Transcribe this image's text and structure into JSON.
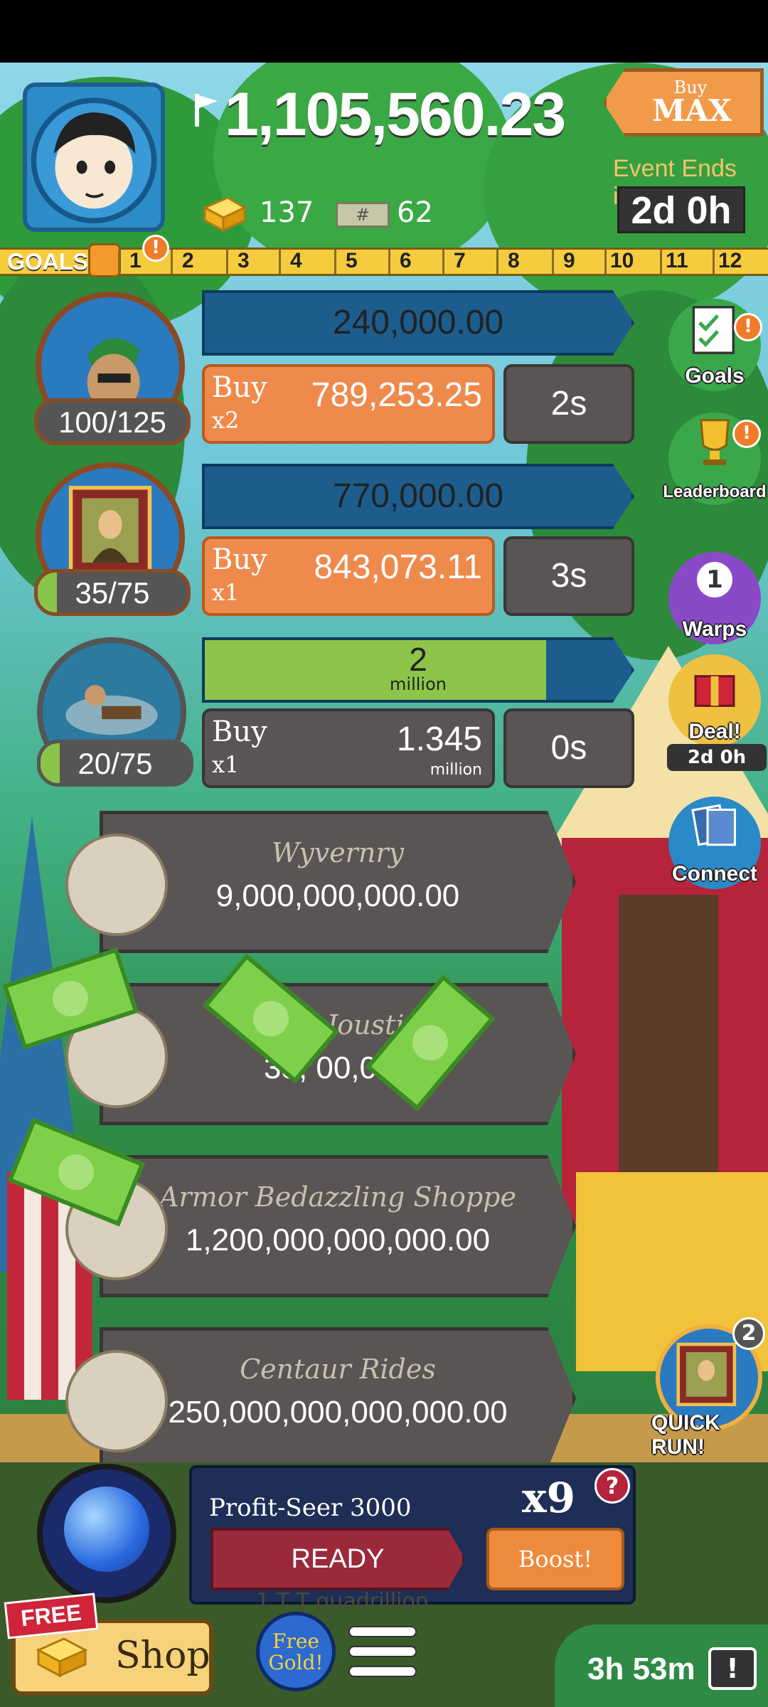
{
  "header": {
    "cash": "1,105,560.23",
    "gold": "137",
    "megatickets": "62",
    "buymax_small": "Buy",
    "buymax_big": "MAX",
    "event_label": "Event Ends in:",
    "event_timer": "2d 0h"
  },
  "goals_strip": {
    "label": "GOALS",
    "alert": "!",
    "numbers": [
      "1",
      "2",
      "3",
      "4",
      "5",
      "6",
      "7",
      "8",
      "9",
      "10",
      "11",
      "12"
    ]
  },
  "businesses": [
    {
      "count": "100/125",
      "count_progress": 0.0,
      "profit": "240,000.00",
      "buy": "Buy",
      "mult": "x2",
      "cost": "789,253.25",
      "timer": "2s"
    },
    {
      "count": "35/75",
      "count_progress": 0.13,
      "profit": "770,000.00",
      "buy": "Buy",
      "mult": "x1",
      "cost": "843,073.11",
      "timer": "3s"
    },
    {
      "count": "20/75",
      "count_progress": 0.13,
      "profit": "2",
      "profit_unit": "million",
      "profit_progress": 0.8,
      "buy": "Buy",
      "mult": "x1",
      "cost": "1.345",
      "cost_unit": "million",
      "timer": "0s"
    }
  ],
  "locked": [
    {
      "name": "Wyvernry",
      "price": "9,000,000,000.00"
    },
    {
      "name": "orn Jousti",
      "price": "33,  00,000"
    },
    {
      "name": "Armor Bedazzling Shoppe",
      "price": "1,200,000,000,000.00"
    },
    {
      "name": "Centaur Rides",
      "price": "250,000,000,000,000.00"
    }
  ],
  "side": {
    "goals": "Goals",
    "leaderboard": "Leaderboard",
    "warps": "Warps",
    "warps_count": "1",
    "deal": "Deal!",
    "deal_timer": "2d 0h",
    "connect": "Connect",
    "alert": "!",
    "quickrun_label": "QUICK RUN!",
    "quickrun_count": "2"
  },
  "manager": {
    "name": "Profit-Seer 3000",
    "multiplier": "x9",
    "help": "?",
    "ready": "READY",
    "boost": "Boost!",
    "ghost": "1 T T quadrillion"
  },
  "bottom": {
    "free_tag": "FREE",
    "shop": "Shop",
    "free_gold_1": "Free",
    "free_gold_2": "Gold!",
    "tv_timer": "3h 53m",
    "tv_icon": "!"
  },
  "icons": {
    "ticket": "#"
  },
  "colors": {
    "accent_orange": "#ee8a4c",
    "profit_blue": "#1c5d8e",
    "progress_green": "#8dc44a"
  }
}
